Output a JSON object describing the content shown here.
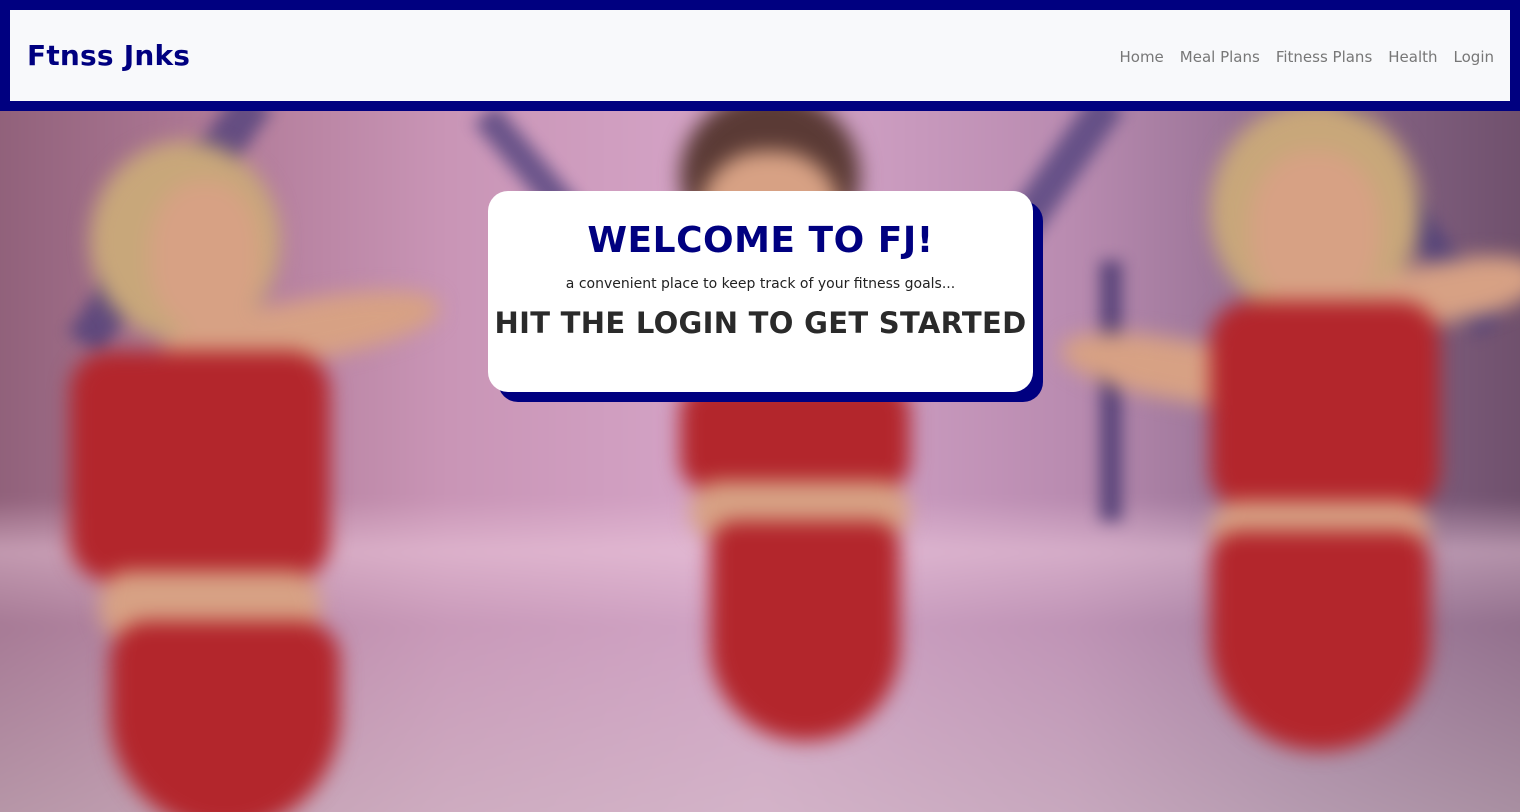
{
  "navbar": {
    "brand": "Ftnss Jnks",
    "links": [
      {
        "label": "Home"
      },
      {
        "label": "Meal Plans"
      },
      {
        "label": "Fitness Plans"
      },
      {
        "label": "Health"
      },
      {
        "label": "Login"
      }
    ]
  },
  "hero": {
    "background_image": "blurred-aerobics-dancers-in-red-leotards",
    "card": {
      "title": "WELCOME TO FJ!",
      "subtitle": "a convenient place to keep track of your fitness goals...",
      "cta": "HIT THE LOGIN TO GET STARTED"
    }
  },
  "colors": {
    "brand": "#000080",
    "nav_bg": "#f8f9fb",
    "nav_link": "#777777",
    "card_bg": "#ffffff",
    "card_shadow": "#000080"
  }
}
